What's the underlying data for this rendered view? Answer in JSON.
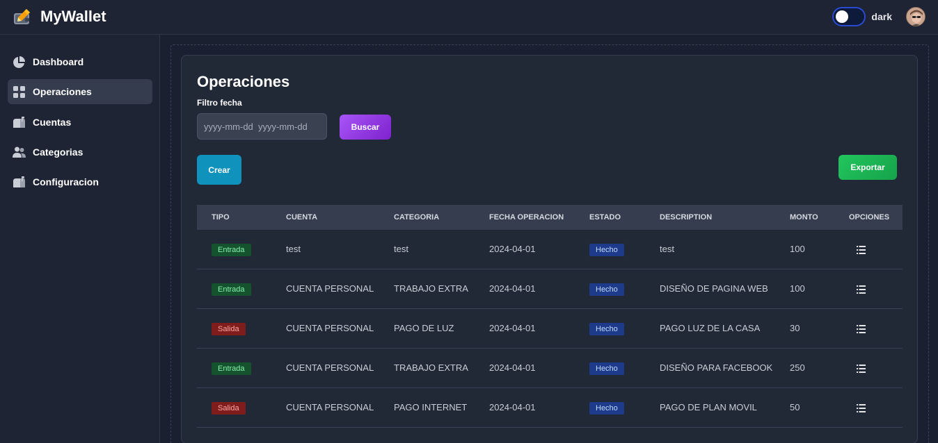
{
  "app": {
    "title": "MyWallet",
    "theme_label": "dark",
    "theme_dark": true
  },
  "sidebar": {
    "items": [
      {
        "label": "Dashboard",
        "icon": "pie-chart-icon",
        "active": false
      },
      {
        "label": "Operaciones",
        "icon": "grid-icon",
        "active": true
      },
      {
        "label": "Cuentas",
        "icon": "mailbox-icon",
        "active": false
      },
      {
        "label": "Categorias",
        "icon": "users-icon",
        "active": false
      },
      {
        "label": "Configuracion",
        "icon": "mailbox-icon",
        "active": false
      }
    ]
  },
  "main": {
    "title": "Operaciones",
    "filter_label": "Filtro fecha",
    "date_placeholder": "yyyy-mm-dd  yyyy-mm-dd",
    "search_button": "Buscar",
    "create_button": "Crear",
    "export_button": "Exportar"
  },
  "table": {
    "columns": [
      "TIPO",
      "CUENTA",
      "CATEGORIA",
      "FECHA OPERACION",
      "ESTADO",
      "DESCRIPTION",
      "MONTO",
      "OPCIONES"
    ],
    "rows": [
      {
        "tipo": "Entrada",
        "cuenta": "test",
        "categoria": "test",
        "fecha": "2024-04-01",
        "estado": "Hecho",
        "descripcion": "test",
        "monto": "100"
      },
      {
        "tipo": "Entrada",
        "cuenta": "CUENTA PERSONAL",
        "categoria": "TRABAJO EXTRA",
        "fecha": "2024-04-01",
        "estado": "Hecho",
        "descripcion": "DISEÑO DE PAGINA WEB",
        "monto": "100"
      },
      {
        "tipo": "Salida",
        "cuenta": "CUENTA PERSONAL",
        "categoria": "PAGO DE LUZ",
        "fecha": "2024-04-01",
        "estado": "Hecho",
        "descripcion": "PAGO LUZ DE LA CASA",
        "monto": "30"
      },
      {
        "tipo": "Entrada",
        "cuenta": "CUENTA PERSONAL",
        "categoria": "TRABAJO EXTRA",
        "fecha": "2024-04-01",
        "estado": "Hecho",
        "descripcion": "DISEÑO PARA FACEBOOK",
        "monto": "250"
      },
      {
        "tipo": "Salida",
        "cuenta": "CUENTA PERSONAL",
        "categoria": "PAGO INTERNET",
        "fecha": "2024-04-01",
        "estado": "Hecho",
        "descripcion": "PAGO DE PLAN MOVIL",
        "monto": "50"
      }
    ]
  },
  "colors": {
    "entrada": "#14532d",
    "salida": "#7f1d1d",
    "hecho": "#1e3a8a",
    "buscar": "#a855f7",
    "crear": "#0f93bd",
    "exportar": "#22c55e"
  }
}
